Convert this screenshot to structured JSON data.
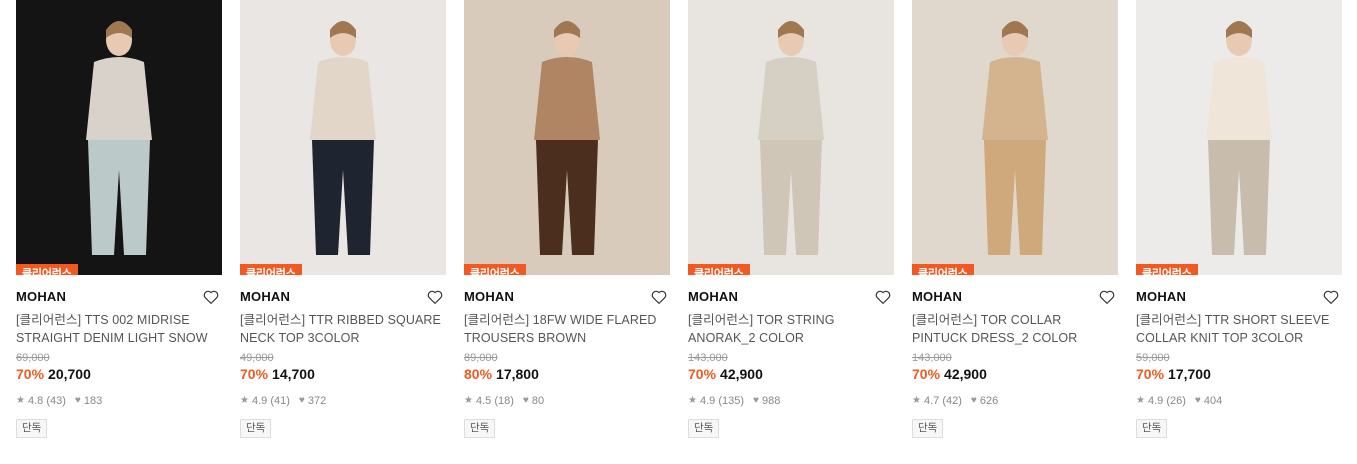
{
  "products": [
    {
      "badge": "클리어런스",
      "brand": "MOHAN",
      "name": "[클리어런스] TTS 002 MIDRISE STRAIGHT DENIM LIGHT SNOW",
      "original_price": "69,000",
      "discount": "70%",
      "price": "20,700",
      "rating": "4.8",
      "reviews": "(43)",
      "likes": "183",
      "tag": "단독",
      "bg": "#141414",
      "fg": "#d9d2cb",
      "accent": "#bcc9c9"
    },
    {
      "badge": "클리어런스",
      "brand": "MOHAN",
      "name": "[클리어런스] TTR RIBBED SQUARE NECK TOP 3COLOR",
      "original_price": "49,000",
      "discount": "70%",
      "price": "14,700",
      "rating": "4.9",
      "reviews": "(41)",
      "likes": "372",
      "tag": "단독",
      "bg": "#e9e6e3",
      "fg": "#e2d6c9",
      "accent": "#1e2530"
    },
    {
      "badge": "클리어런스",
      "brand": "MOHAN",
      "name": "[클리어런스] 18FW WIDE FLARED TROUSERS BROWN",
      "original_price": "89,000",
      "discount": "80%",
      "price": "17,800",
      "rating": "4.5",
      "reviews": "(18)",
      "likes": "80",
      "tag": "단독",
      "bg": "#d8cbbb",
      "fg": "#b08563",
      "accent": "#4b2e1e"
    },
    {
      "badge": "클리어런스",
      "brand": "MOHAN",
      "name": "[클리어런스] TOR STRING ANORAK_2 COLOR",
      "original_price": "143,000",
      "discount": "70%",
      "price": "42,900",
      "rating": "4.9",
      "reviews": "(135)",
      "likes": "988",
      "tag": "단독",
      "bg": "#e8e5e0",
      "fg": "#d6cfc3",
      "accent": "#cfc6b8"
    },
    {
      "badge": "클리어런스",
      "brand": "MOHAN",
      "name": "[클리어런스] TOR COLLAR PINTUCK DRESS_2 COLOR",
      "original_price": "143,000",
      "discount": "70%",
      "price": "42,900",
      "rating": "4.7",
      "reviews": "(42)",
      "likes": "626",
      "tag": "단독",
      "bg": "#e0d8cd",
      "fg": "#d3b48e",
      "accent": "#cfa97c"
    },
    {
      "badge": "클리어런스",
      "brand": "MOHAN",
      "name": "[클리어런스] TTR SHORT SLEEVE COLLAR KNIT TOP 3COLOR",
      "original_price": "59,000",
      "discount": "70%",
      "price": "17,700",
      "rating": "4.9",
      "reviews": "(26)",
      "likes": "404",
      "tag": "단독",
      "bg": "#ecebe9",
      "fg": "#efe6d9",
      "accent": "#c8bcad"
    }
  ]
}
